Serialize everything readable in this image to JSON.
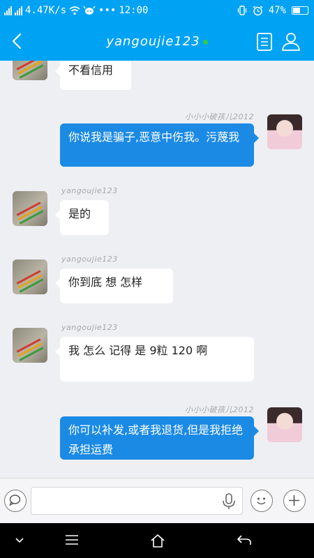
{
  "status_bar": {
    "network_speed": "4.47K/s",
    "dots": "•••",
    "time": "12:00",
    "battery": "47%"
  },
  "header": {
    "title": "yangoujie123"
  },
  "messages": [
    {
      "side": "in",
      "sender": "",
      "text": "不看信用"
    },
    {
      "side": "out",
      "sender": "小小小破孩儿2012",
      "text": "你说我是骗子,恶意中伤我。污蔑我"
    },
    {
      "side": "in",
      "sender": "yangoujie123",
      "text": "是的"
    },
    {
      "side": "in",
      "sender": "yangoujie123",
      "text": "你到底 想 怎样"
    },
    {
      "side": "in",
      "sender": "yangoujie123",
      "text": "我 怎么 记得 是 9粒 120 啊"
    },
    {
      "side": "out",
      "sender": "小小小破孩儿2012",
      "text": "你可以补发,或者我退货,但是我拒绝承担运费"
    }
  ],
  "input": {
    "value": "",
    "placeholder": ""
  },
  "icons": {
    "back": "back-arrow-icon",
    "profile": "chat-log-icon",
    "person": "person-icon",
    "voice": "voice-bubble-icon",
    "mic": "microphone-icon",
    "emoji": "emoji-icon",
    "plus": "plus-icon"
  },
  "colors": {
    "primary": "#00a2f3",
    "outgoing_bubble": "#1b8ae5",
    "background": "#eeeff3",
    "online": "#2ecc40"
  }
}
